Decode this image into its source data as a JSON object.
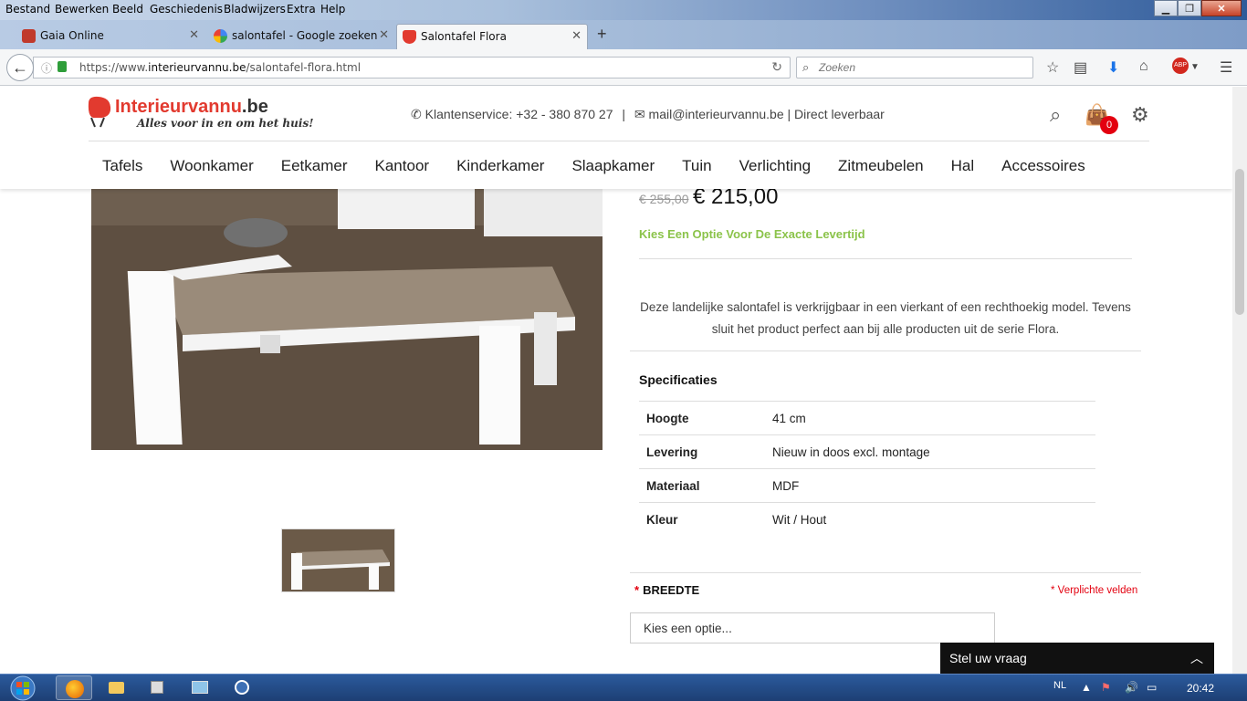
{
  "menubar": {
    "items": [
      "Bestand",
      "Bewerken",
      "Beeld",
      "Geschiedenis",
      "Bladwijzers",
      "Extra",
      "Help"
    ]
  },
  "tabs": [
    {
      "title": "Gaia Online",
      "icon": "gaia-favicon"
    },
    {
      "title": "salontafel - Google zoeken",
      "icon": "google-favicon"
    },
    {
      "title": "Salontafel Flora",
      "icon": "interieurvannu-favicon",
      "active": true
    }
  ],
  "nav": {
    "url_prefix": "https://www.",
    "url_domain": "interieurvannu.be",
    "url_path": "/salontafel-flora.html",
    "search_placeholder": "Zoeken"
  },
  "site": {
    "logo_name": "Interieurvannu",
    "logo_tld": ".be",
    "logo_tagline": "Alles voor in en om het huis!",
    "customer_service": "Klantenservice: +32 - 380 870 27",
    "separator": "|",
    "email_line": "mail@interieurvannu.be | Direct leverbaar",
    "cart_count": "0",
    "menu": [
      "Tafels",
      "Woonkamer",
      "Eetkamer",
      "Kantoor",
      "Kinderkamer",
      "Slaapkamer",
      "Tuin",
      "Verlichting",
      "Zitmeubelen",
      "Hal",
      "Accessoires"
    ]
  },
  "product": {
    "old_price": "€ 255,00",
    "new_price": "€ 215,00",
    "lead_time": "Kies Een Optie Voor De Exacte Levertijd",
    "description": "Deze landelijke salontafel is verkrijgbaar in een vierkant of een rechthoekig model. Tevens sluit het product perfect aan bij alle producten uit de serie Flora.",
    "specs_title": "Specificaties",
    "specs": [
      {
        "key": "Hoogte",
        "value": "41 cm"
      },
      {
        "key": "Levering",
        "value": "Nieuw in doos excl. montage"
      },
      {
        "key": "Materiaal",
        "value": "MDF"
      },
      {
        "key": "Kleur",
        "value": "Wit / Hout"
      }
    ],
    "option_label": "BREEDTE",
    "required_note": "* Verplichte velden",
    "option_placeholder": "Kies een optie..."
  },
  "chat": {
    "label": "Stel uw vraag"
  },
  "taskbar": {
    "language": "NL",
    "clock": "20:42"
  },
  "colors": {
    "brand_red": "#e23a2f",
    "accent_green": "#8bc34a",
    "required_red": "#e3000f"
  }
}
